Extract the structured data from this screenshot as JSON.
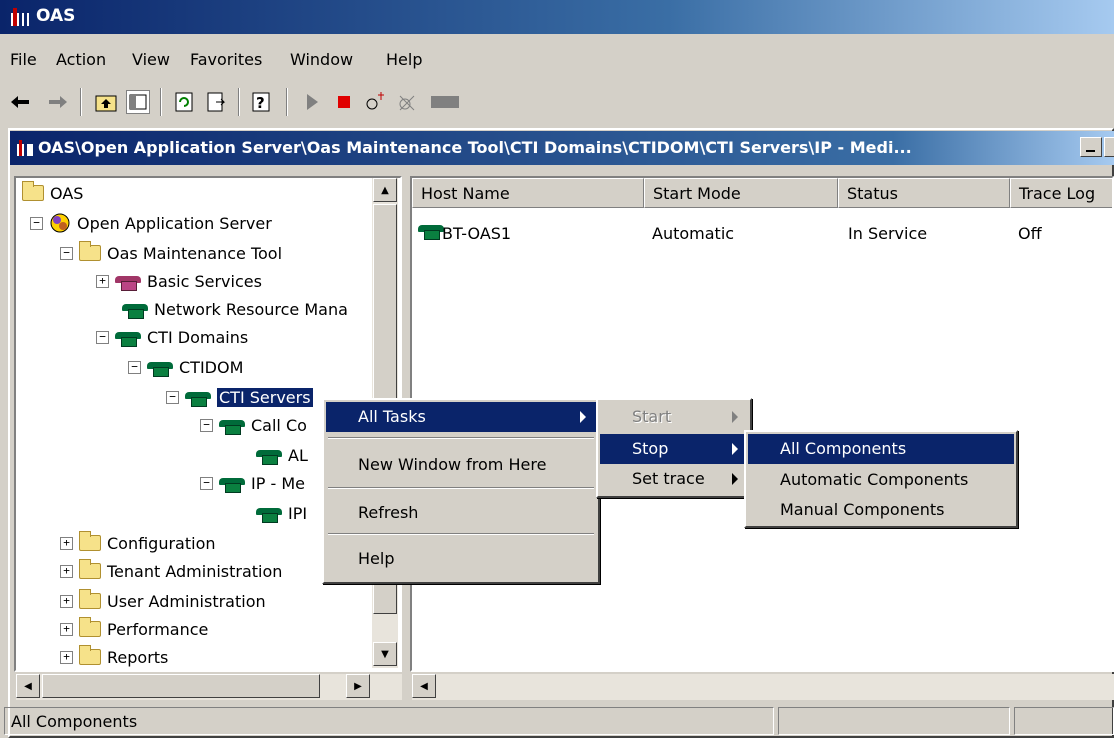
{
  "window": {
    "title": "OAS"
  },
  "menubar": [
    {
      "label": "File"
    },
    {
      "label": "Action"
    },
    {
      "label": "View"
    },
    {
      "label": "Favorites"
    },
    {
      "label": "Window"
    },
    {
      "label": "Help"
    }
  ],
  "inner_window": {
    "title": "OAS\\Open Application Server\\Oas Maintenance Tool\\CTI Domains\\CTIDOM\\CTI Servers\\IP - Medi..."
  },
  "tree": {
    "items": [
      {
        "label": "OAS"
      },
      {
        "label": "Open Application Server"
      },
      {
        "label": "Oas Maintenance Tool"
      },
      {
        "label": "Basic Services"
      },
      {
        "label": "Network Resource Mana"
      },
      {
        "label": "CTI Domains"
      },
      {
        "label": "CTIDOM"
      },
      {
        "label": "CTI Servers"
      },
      {
        "label": "Call Co"
      },
      {
        "label": "AL"
      },
      {
        "label": "IP - Me"
      },
      {
        "label": "IPI"
      },
      {
        "label": "Configuration"
      },
      {
        "label": "Tenant Administration"
      },
      {
        "label": "User Administration"
      },
      {
        "label": "Performance"
      },
      {
        "label": "Reports"
      }
    ]
  },
  "list": {
    "columns": [
      "Host Name",
      "Start Mode",
      "Status",
      "Trace Log"
    ],
    "rows": [
      {
        "host": "BT-OAS1",
        "start_mode": "Automatic",
        "status": "In Service",
        "trace_log": "Off"
      }
    ]
  },
  "context_menu": {
    "items": [
      {
        "label": "All Tasks"
      },
      {
        "label": "New Window from Here"
      },
      {
        "label": "Refresh"
      },
      {
        "label": "Help"
      }
    ]
  },
  "submenu_tasks": {
    "items": [
      {
        "label": "Start"
      },
      {
        "label": "Stop"
      },
      {
        "label": "Set trace"
      }
    ]
  },
  "submenu_stop": {
    "items": [
      {
        "label": "All Components"
      },
      {
        "label": "Automatic Components"
      },
      {
        "label": "Manual Components"
      }
    ]
  },
  "statusbar": {
    "text": "All Components"
  },
  "colors": {
    "title_active": "#0a246a",
    "highlight": "#0a246a",
    "face": "#d4d0c8"
  },
  "icons": {
    "toolbar": [
      "back-arrow-icon",
      "forward-arrow-icon",
      "up-one-level-icon",
      "show-hide-tree-icon",
      "refresh-icon",
      "export-list-icon",
      "help-icon",
      "start-service-icon",
      "stop-service-icon",
      "trace-on-icon",
      "trace-off-icon",
      "disabled-icon"
    ]
  }
}
